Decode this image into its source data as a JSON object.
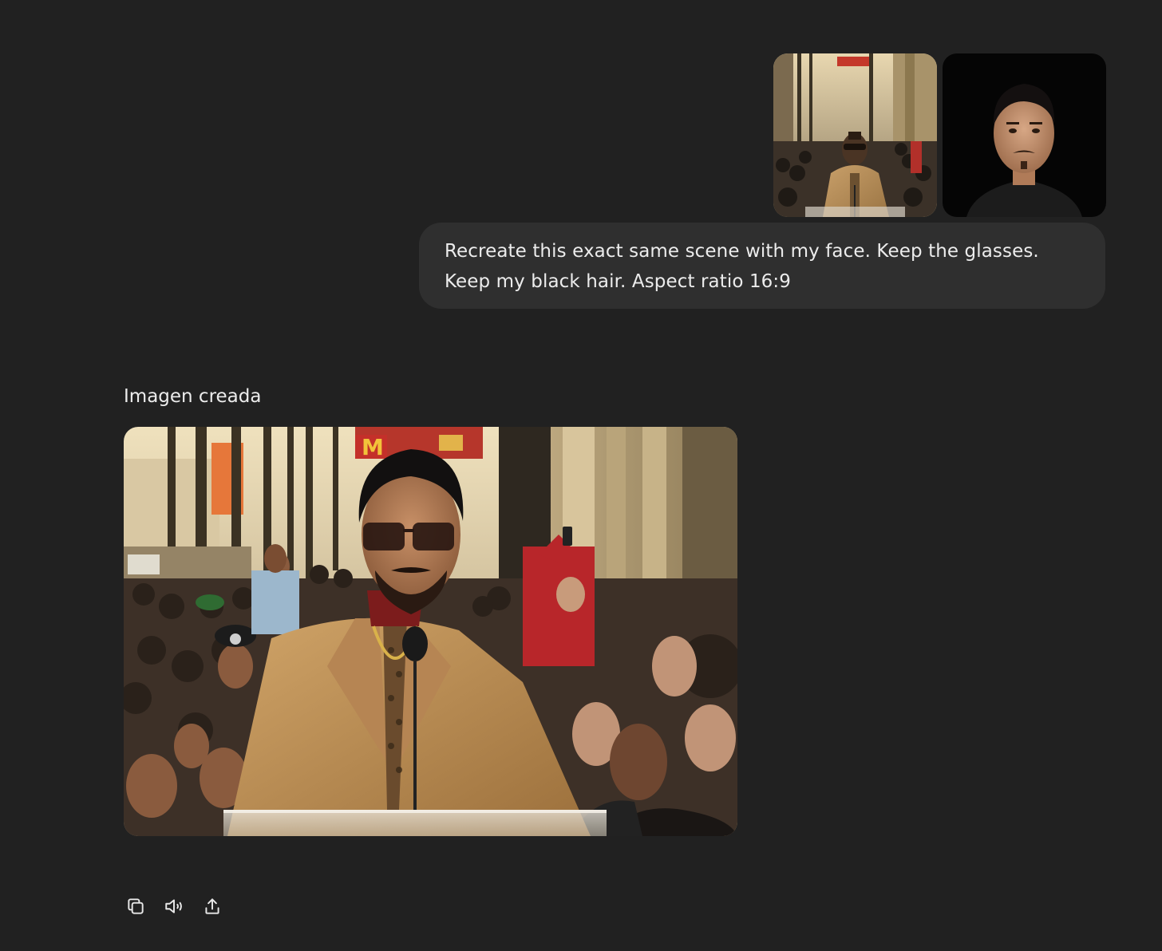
{
  "conversation": {
    "user_message": {
      "attachments": [
        {
          "name": "reference-scene-image"
        },
        {
          "name": "user-face-portrait"
        }
      ],
      "lines": [
        "Recreate this exact same scene with my face. Keep the glasses.",
        "Keep my black hair. Aspect ratio 16:9"
      ]
    },
    "assistant_message": {
      "label": "Imagen creada"
    },
    "actions": [
      {
        "icon": "copy-icon"
      },
      {
        "icon": "speaker-icon"
      },
      {
        "icon": "share-icon"
      }
    ]
  },
  "colors": {
    "background": "#212121",
    "bubble": "#2f2f2f",
    "text": "#ececec",
    "icon": "#e8e8e8"
  }
}
